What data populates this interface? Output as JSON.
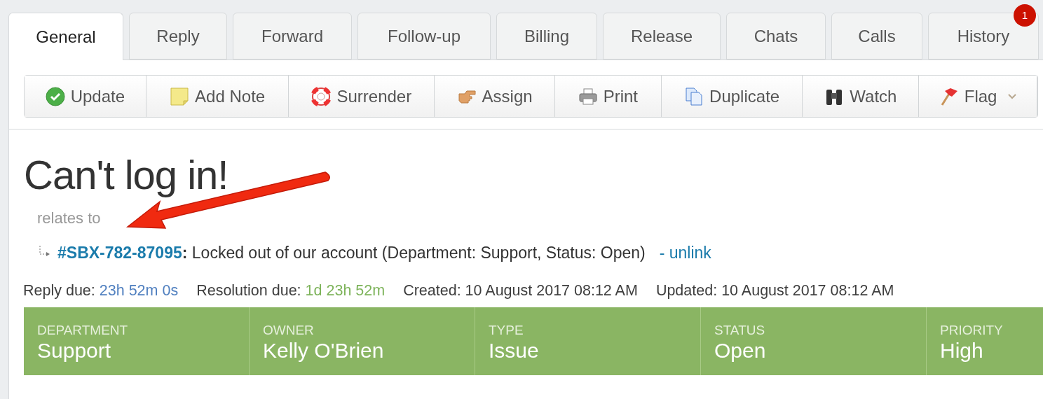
{
  "tabs": [
    {
      "label": "General",
      "selected": true
    },
    {
      "label": "Reply",
      "selected": false
    },
    {
      "label": "Forward",
      "selected": false
    },
    {
      "label": "Follow-up",
      "selected": false
    },
    {
      "label": "Billing",
      "selected": false
    },
    {
      "label": "Release",
      "selected": false
    },
    {
      "label": "Chats",
      "selected": false
    },
    {
      "label": "Calls",
      "selected": false
    },
    {
      "label": "History",
      "selected": false,
      "badge": "1"
    }
  ],
  "toolbar": [
    {
      "label": "Update",
      "kind": "check"
    },
    {
      "label": "Add Note",
      "kind": "note"
    },
    {
      "label": "Surrender",
      "kind": "lifebuoy"
    },
    {
      "label": "Assign",
      "kind": "hand"
    },
    {
      "label": "Print",
      "kind": "printer"
    },
    {
      "label": "Duplicate",
      "kind": "copy"
    },
    {
      "label": "Watch",
      "kind": "binoculars"
    },
    {
      "label": "Flag",
      "kind": "flag",
      "dropdown": true
    }
  ],
  "ticket": {
    "title": "Can't log in!",
    "relates_label": "relates to",
    "related": {
      "id": "#SBX-782-87095",
      "summary": "**:** Locked out of our account (Department: Support, Status: Open)",
      "unlink": "- unlink"
    },
    "dates": [
      {
        "label": "Reply due:",
        "value": "23h 52m 0s",
        "color": "#4f7fbf"
      },
      {
        "label": "Resolution due:",
        "value": "1d 23h 52m",
        "color": "#7db35a"
      },
      {
        "label": "Created:",
        "value": "10 August 2017 08:12 AM",
        "color": "#3e3e3e"
      },
      {
        "label": "Updated:",
        "value": "10 August 2017 08:12 AM",
        "color": "#3e3e3e"
      }
    ],
    "properties": [
      {
        "label": "DEPARTMENT",
        "value": "Support"
      },
      {
        "label": "OWNER",
        "value": "Kelly O'Brien"
      },
      {
        "label": "TYPE",
        "value": "Issue"
      },
      {
        "label": "STATUS",
        "value": "Open"
      },
      {
        "label": "PRIORITY",
        "value": "High"
      }
    ]
  }
}
